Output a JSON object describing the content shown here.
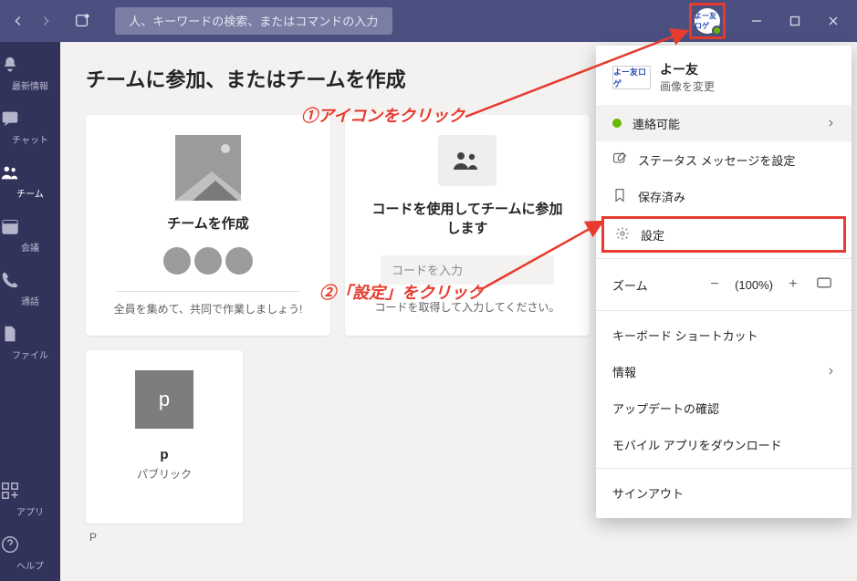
{
  "titlebar": {
    "search_placeholder": "人、キーワードの検索、またはコマンドの入力",
    "avatar_text": "よー友ロゲ"
  },
  "rail": {
    "items": [
      {
        "label": "最新情報"
      },
      {
        "label": "チャット"
      },
      {
        "label": "チーム"
      },
      {
        "label": "会議"
      },
      {
        "label": "通話"
      },
      {
        "label": "ファイル"
      }
    ],
    "apps_label": "アプリ",
    "help_label": "ヘルプ"
  },
  "page": {
    "title": "チームに参加、またはチームを作成",
    "card_create": {
      "title": "チームを作成",
      "subtitle": "全員を集めて、共同で作業しましょう!"
    },
    "card_join": {
      "title": "コードを使用してチームに参加します",
      "placeholder": "コードを入力",
      "subtitle": "コードを取得して入力してください。"
    },
    "card_p": {
      "letter": "p",
      "title": "p",
      "subtitle": "パブリック"
    },
    "stray": "P"
  },
  "panel": {
    "logo_text": "よー友ロゲ",
    "user_name": "よー友",
    "change_image": "画像を変更",
    "status": "連絡可能",
    "status_message": "ステータス メッセージを設定",
    "saved": "保存済み",
    "settings": "設定",
    "zoom_label": "ズーム",
    "zoom_value": "(100%)",
    "shortcuts": "キーボード ショートカット",
    "info": "情報",
    "updates": "アップデートの確認",
    "mobile": "モバイル アプリをダウンロード",
    "signout": "サインアウト"
  },
  "annotations": {
    "a1": "①アイコンをクリック",
    "a2": "②「設定」をクリック"
  }
}
